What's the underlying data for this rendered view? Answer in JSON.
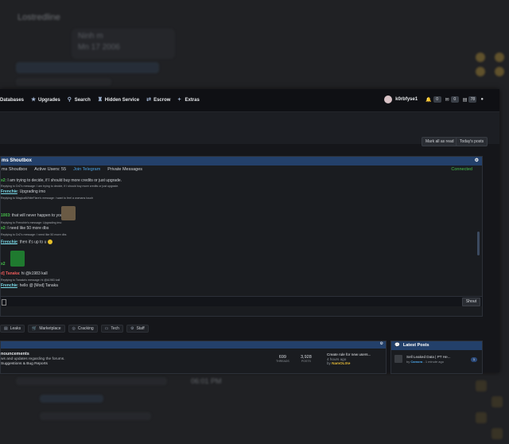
{
  "background": {
    "chat_name": "Lostredline",
    "card_line1": "Ninh m",
    "card_line2": "Mn 17 2006",
    "time": "06:01 PM"
  },
  "nav": {
    "items": [
      {
        "label": "Databases",
        "icon": "database-icon"
      },
      {
        "label": "Upgrades",
        "icon": "star-icon"
      },
      {
        "label": "Search",
        "icon": "search-icon"
      },
      {
        "label": "Hidden Service",
        "icon": "hidden-service-icon"
      },
      {
        "label": "Escrow",
        "icon": "exchange-icon"
      },
      {
        "label": "Extras",
        "icon": "plus-icon"
      }
    ],
    "username": "k0rbfyse1",
    "bell_count": "0",
    "mail_count": "0",
    "credits": "78"
  },
  "header_buttons": {
    "mark_read": "Mark all as read",
    "todays_posts": "Today's posts"
  },
  "shoutbox": {
    "title": "ms Shoutbox",
    "tabs": [
      "ms Shoutbox",
      "Active Users: 55",
      "Join Telegram",
      "Private Messages"
    ],
    "status": "Connected",
    "send_label": "Shout",
    "messages": [
      {
        "user": "x2",
        "text": ": I am trying to decide, if I should buy more credits or just upgrade."
      },
      {
        "small": "Replying to DrZ's message: I am trying to decide, if I should buy more credits or just upgrade."
      },
      {
        "user": "Frenchie",
        "text": ": Upgrading imo"
      },
      {
        "small": "Replying to MagicalWhiteFlare's message: i want to feel a womans touch"
      },
      {
        "user": "1003",
        "text": ": that will never happen to you"
      },
      {
        "small": "Replying to Frenchie's message: Upgrading imo"
      },
      {
        "user": "x2",
        "text": ": I need like 50 more dbs"
      },
      {
        "small": "Replying to DrZ's message: I need like 50 more dbs"
      },
      {
        "user": "Frenchie",
        "text": ": then it's up to u"
      },
      {
        "user": "x2",
        "text": ""
      },
      {
        "user": "d] Tanaka",
        "text": ": hi @k1983 kall"
      },
      {
        "small": "Replying to Tanaka's message: hi @k1983 kall"
      },
      {
        "user": "Frenchie",
        "text": ": hello @ [Mod] Tanaka"
      }
    ]
  },
  "categories": [
    {
      "label": "Leaks",
      "icon": "leaks-icon"
    },
    {
      "label": "Marketplace",
      "icon": "cart-icon"
    },
    {
      "label": "Cracking",
      "icon": "crack-icon"
    },
    {
      "label": "Tech",
      "icon": "tech-icon"
    },
    {
      "label": "Staff",
      "icon": "staff-icon"
    }
  ],
  "forum": {
    "title": "nouncements",
    "desc": "ws and updates regarding the forums.",
    "sub": "Suggestions & Bug Reports",
    "threads": "699",
    "threads_label": "THREADS",
    "posts": "3,928",
    "posts_label": "POSTS",
    "last_title": "Create rule for new users...",
    "last_ago": "4 hours ago",
    "last_by_prefix": "by",
    "last_by": "NamOLIXe"
  },
  "latest": {
    "title": "Latest Posts",
    "post_title": "Sell Leaked Data | PT He...",
    "post_by_prefix": "by",
    "post_by": "Camora",
    "post_ago": " - 1 minute ago",
    "count": "1"
  }
}
